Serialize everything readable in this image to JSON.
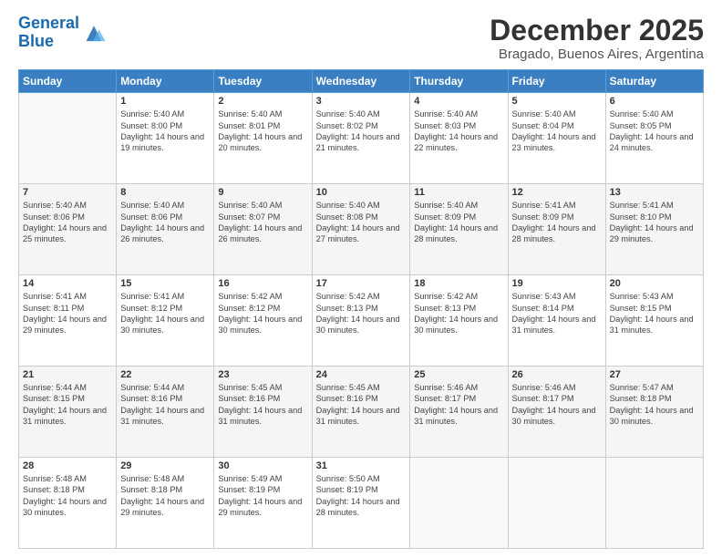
{
  "logo": {
    "line1": "General",
    "line2": "Blue"
  },
  "title": "December 2025",
  "location": "Bragado, Buenos Aires, Argentina",
  "days_header": [
    "Sunday",
    "Monday",
    "Tuesday",
    "Wednesday",
    "Thursday",
    "Friday",
    "Saturday"
  ],
  "weeks": [
    [
      {
        "num": "",
        "info": ""
      },
      {
        "num": "1",
        "info": "Sunrise: 5:40 AM\nSunset: 8:00 PM\nDaylight: 14 hours\nand 19 minutes."
      },
      {
        "num": "2",
        "info": "Sunrise: 5:40 AM\nSunset: 8:01 PM\nDaylight: 14 hours\nand 20 minutes."
      },
      {
        "num": "3",
        "info": "Sunrise: 5:40 AM\nSunset: 8:02 PM\nDaylight: 14 hours\nand 21 minutes."
      },
      {
        "num": "4",
        "info": "Sunrise: 5:40 AM\nSunset: 8:03 PM\nDaylight: 14 hours\nand 22 minutes."
      },
      {
        "num": "5",
        "info": "Sunrise: 5:40 AM\nSunset: 8:04 PM\nDaylight: 14 hours\nand 23 minutes."
      },
      {
        "num": "6",
        "info": "Sunrise: 5:40 AM\nSunset: 8:05 PM\nDaylight: 14 hours\nand 24 minutes."
      }
    ],
    [
      {
        "num": "7",
        "info": "Sunrise: 5:40 AM\nSunset: 8:06 PM\nDaylight: 14 hours\nand 25 minutes."
      },
      {
        "num": "8",
        "info": "Sunrise: 5:40 AM\nSunset: 8:06 PM\nDaylight: 14 hours\nand 26 minutes."
      },
      {
        "num": "9",
        "info": "Sunrise: 5:40 AM\nSunset: 8:07 PM\nDaylight: 14 hours\nand 26 minutes."
      },
      {
        "num": "10",
        "info": "Sunrise: 5:40 AM\nSunset: 8:08 PM\nDaylight: 14 hours\nand 27 minutes."
      },
      {
        "num": "11",
        "info": "Sunrise: 5:40 AM\nSunset: 8:09 PM\nDaylight: 14 hours\nand 28 minutes."
      },
      {
        "num": "12",
        "info": "Sunrise: 5:41 AM\nSunset: 8:09 PM\nDaylight: 14 hours\nand 28 minutes."
      },
      {
        "num": "13",
        "info": "Sunrise: 5:41 AM\nSunset: 8:10 PM\nDaylight: 14 hours\nand 29 minutes."
      }
    ],
    [
      {
        "num": "14",
        "info": "Sunrise: 5:41 AM\nSunset: 8:11 PM\nDaylight: 14 hours\nand 29 minutes."
      },
      {
        "num": "15",
        "info": "Sunrise: 5:41 AM\nSunset: 8:12 PM\nDaylight: 14 hours\nand 30 minutes."
      },
      {
        "num": "16",
        "info": "Sunrise: 5:42 AM\nSunset: 8:12 PM\nDaylight: 14 hours\nand 30 minutes."
      },
      {
        "num": "17",
        "info": "Sunrise: 5:42 AM\nSunset: 8:13 PM\nDaylight: 14 hours\nand 30 minutes."
      },
      {
        "num": "18",
        "info": "Sunrise: 5:42 AM\nSunset: 8:13 PM\nDaylight: 14 hours\nand 30 minutes."
      },
      {
        "num": "19",
        "info": "Sunrise: 5:43 AM\nSunset: 8:14 PM\nDaylight: 14 hours\nand 31 minutes."
      },
      {
        "num": "20",
        "info": "Sunrise: 5:43 AM\nSunset: 8:15 PM\nDaylight: 14 hours\nand 31 minutes."
      }
    ],
    [
      {
        "num": "21",
        "info": "Sunrise: 5:44 AM\nSunset: 8:15 PM\nDaylight: 14 hours\nand 31 minutes."
      },
      {
        "num": "22",
        "info": "Sunrise: 5:44 AM\nSunset: 8:16 PM\nDaylight: 14 hours\nand 31 minutes."
      },
      {
        "num": "23",
        "info": "Sunrise: 5:45 AM\nSunset: 8:16 PM\nDaylight: 14 hours\nand 31 minutes."
      },
      {
        "num": "24",
        "info": "Sunrise: 5:45 AM\nSunset: 8:16 PM\nDaylight: 14 hours\nand 31 minutes."
      },
      {
        "num": "25",
        "info": "Sunrise: 5:46 AM\nSunset: 8:17 PM\nDaylight: 14 hours\nand 31 minutes."
      },
      {
        "num": "26",
        "info": "Sunrise: 5:46 AM\nSunset: 8:17 PM\nDaylight: 14 hours\nand 30 minutes."
      },
      {
        "num": "27",
        "info": "Sunrise: 5:47 AM\nSunset: 8:18 PM\nDaylight: 14 hours\nand 30 minutes."
      }
    ],
    [
      {
        "num": "28",
        "info": "Sunrise: 5:48 AM\nSunset: 8:18 PM\nDaylight: 14 hours\nand 30 minutes."
      },
      {
        "num": "29",
        "info": "Sunrise: 5:48 AM\nSunset: 8:18 PM\nDaylight: 14 hours\nand 29 minutes."
      },
      {
        "num": "30",
        "info": "Sunrise: 5:49 AM\nSunset: 8:19 PM\nDaylight: 14 hours\nand 29 minutes."
      },
      {
        "num": "31",
        "info": "Sunrise: 5:50 AM\nSunset: 8:19 PM\nDaylight: 14 hours\nand 28 minutes."
      },
      {
        "num": "",
        "info": ""
      },
      {
        "num": "",
        "info": ""
      },
      {
        "num": "",
        "info": ""
      }
    ]
  ]
}
